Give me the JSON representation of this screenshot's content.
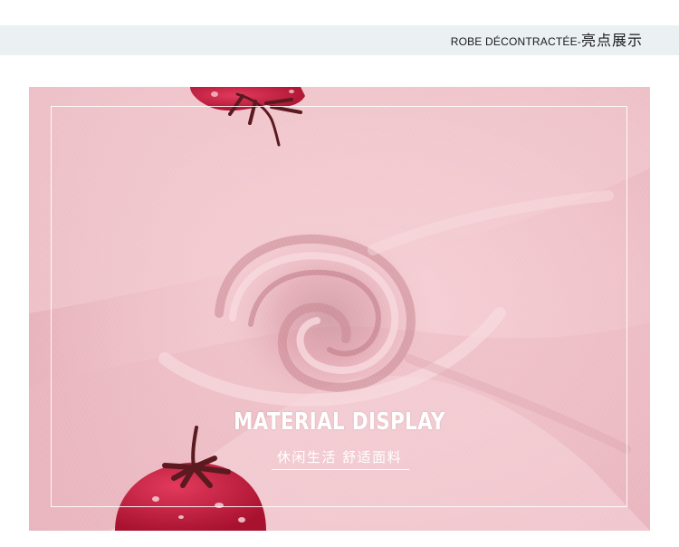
{
  "header": {
    "title_latin": "ROBE DÉCONTRACTÉE-",
    "title_cjk": "亮点展示",
    "band_color": "#ebf1f3"
  },
  "photo": {
    "fabric_color": "#f1c5cc",
    "caption_title": "MATERIAL DISPLAY",
    "caption_subtitle": "休闲生活 舒适面料"
  }
}
